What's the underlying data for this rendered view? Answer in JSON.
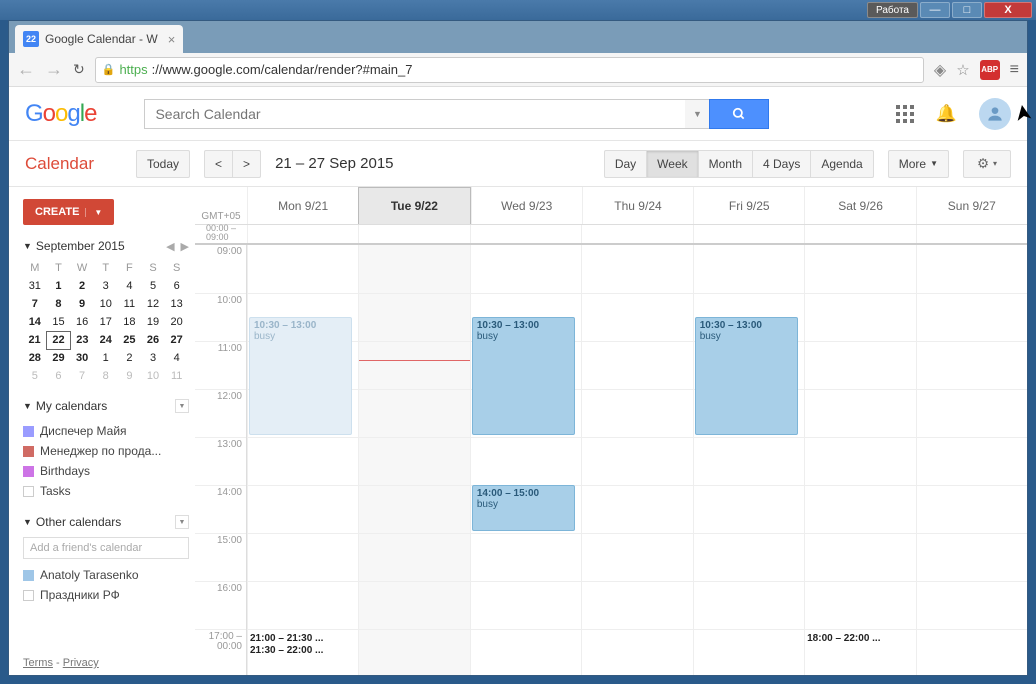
{
  "window": {
    "rabota": "Работа"
  },
  "tab": {
    "title": "Google Calendar - W"
  },
  "address": {
    "scheme": "https",
    "url": "://www.google.com/calendar/render?#main_7"
  },
  "search": {
    "placeholder": "Search Calendar"
  },
  "toolbar": {
    "appTitle": "Calendar",
    "today": "Today",
    "dateRange": "21 – 27 Sep 2015",
    "views": {
      "day": "Day",
      "week": "Week",
      "month": "Month",
      "fourDays": "4 Days",
      "agenda": "Agenda"
    },
    "more": "More"
  },
  "sidebar": {
    "create": "CREATE",
    "miniMonth": "September 2015",
    "dow": [
      "M",
      "T",
      "W",
      "T",
      "F",
      "S",
      "S"
    ],
    "weeks": [
      [
        {
          "d": "31"
        },
        {
          "d": "1",
          "b": 1
        },
        {
          "d": "2",
          "b": 1
        },
        {
          "d": "3"
        },
        {
          "d": "4"
        },
        {
          "d": "5"
        },
        {
          "d": "6"
        }
      ],
      [
        {
          "d": "7",
          "b": 1
        },
        {
          "d": "8",
          "b": 1
        },
        {
          "d": "9",
          "b": 1
        },
        {
          "d": "10"
        },
        {
          "d": "11"
        },
        {
          "d": "12"
        },
        {
          "d": "13"
        }
      ],
      [
        {
          "d": "14",
          "b": 1
        },
        {
          "d": "15"
        },
        {
          "d": "16"
        },
        {
          "d": "17"
        },
        {
          "d": "18"
        },
        {
          "d": "19"
        },
        {
          "d": "20"
        }
      ],
      [
        {
          "d": "21",
          "b": 1
        },
        {
          "d": "22",
          "t": 1,
          "b": 1
        },
        {
          "d": "23",
          "b": 1
        },
        {
          "d": "24",
          "b": 1
        },
        {
          "d": "25",
          "b": 1
        },
        {
          "d": "26",
          "b": 1
        },
        {
          "d": "27",
          "b": 1
        }
      ],
      [
        {
          "d": "28",
          "b": 1
        },
        {
          "d": "29",
          "b": 1
        },
        {
          "d": "30",
          "b": 1
        },
        {
          "d": "1"
        },
        {
          "d": "2"
        },
        {
          "d": "3"
        },
        {
          "d": "4"
        }
      ],
      [
        {
          "d": "5"
        },
        {
          "d": "6"
        },
        {
          "d": "7"
        },
        {
          "d": "8"
        },
        {
          "d": "9"
        },
        {
          "d": "10"
        },
        {
          "d": "11"
        }
      ]
    ],
    "myCalendars": "My calendars",
    "myList": [
      {
        "label": "Диспечер Майя",
        "color": "#9a9cff",
        "filled": true
      },
      {
        "label": "Менеджер по прода...",
        "color": "#d06b64",
        "filled": true
      },
      {
        "label": "Birthdays",
        "color": "#cd74e6",
        "filled": true
      },
      {
        "label": "Tasks",
        "color": "#cccccc",
        "filled": false
      }
    ],
    "otherCalendars": "Other calendars",
    "addFriend": "Add a friend's calendar",
    "otherList": [
      {
        "label": "Anatoly Tarasenko",
        "color": "#9fc6e7",
        "filled": true
      },
      {
        "label": "Праздники РФ",
        "color": "#cccccc",
        "filled": false
      }
    ],
    "terms": "Terms",
    "privacy": "Privacy"
  },
  "grid": {
    "gmt": "GMT+05",
    "days": [
      "Mon 9/21",
      "Tue 9/22",
      "Wed 9/23",
      "Thu 9/24",
      "Fri 9/25",
      "Sat 9/26",
      "Sun 9/27"
    ],
    "todayIndex": 1,
    "alldayLabel": "00:00 –\n09:00",
    "hours": [
      "09:00",
      "10:00",
      "11:00",
      "12:00",
      "13:00",
      "14:00",
      "15:00",
      "16:00",
      "17:00 –\n00:00"
    ],
    "events": [
      {
        "day": 0,
        "startRow": 1.5,
        "span": 2.5,
        "time": "10:30 – 13:00",
        "title": "busy",
        "past": true
      },
      {
        "day": 2,
        "startRow": 1.5,
        "span": 2.5,
        "time": "10:30 – 13:00",
        "title": "busy"
      },
      {
        "day": 4,
        "startRow": 1.5,
        "span": 2.5,
        "time": "10:30 – 13:00",
        "title": "busy"
      },
      {
        "day": 2,
        "startRow": 5,
        "span": 1,
        "time": "14:00 – 15:00",
        "title": "busy"
      }
    ],
    "bottomEvents": [
      {
        "day": 0,
        "line": 0,
        "text": "21:00 – 21:30  ..."
      },
      {
        "day": 0,
        "line": 1,
        "text": "21:30 – 22:00  ..."
      },
      {
        "day": 5,
        "line": 0,
        "text": "18:00 – 22:00  ..."
      }
    ],
    "nowRow": 2.4
  }
}
